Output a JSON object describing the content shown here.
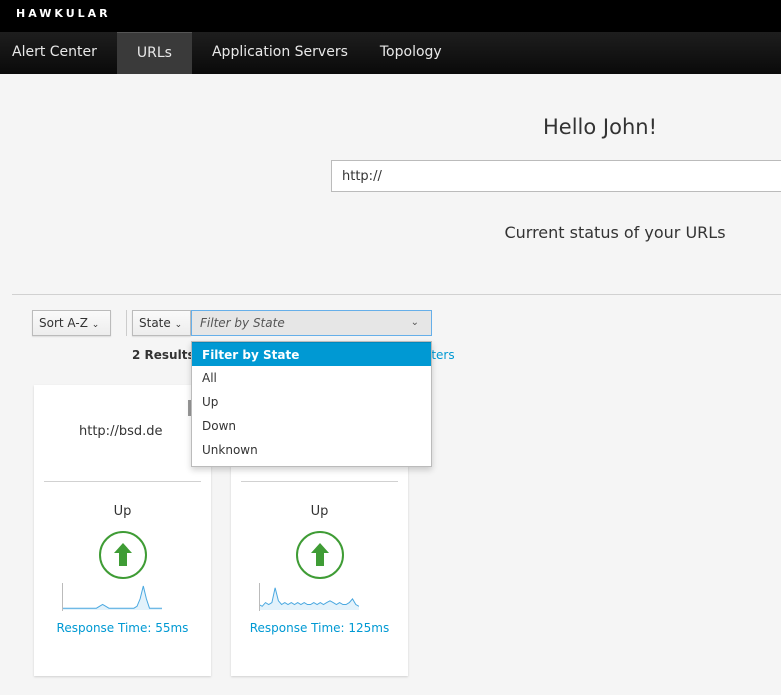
{
  "app": {
    "logo": "HAWKULAR"
  },
  "nav": [
    {
      "label": "Alert Center"
    },
    {
      "label": "URLs",
      "active": true
    },
    {
      "label": "Application Servers"
    },
    {
      "label": "Topology"
    }
  ],
  "main": {
    "greeting": "Hello John!",
    "url_input": {
      "value": "http://"
    },
    "subtitle": "Current status of your URLs"
  },
  "toolbar": {
    "sort_label": "Sort A-Z",
    "state_label": "State",
    "filter_placeholder": "Filter by State",
    "results": "2 Results",
    "clear_filters": "lters"
  },
  "dropdown": {
    "options": [
      "Filter by State",
      "All",
      "Up",
      "Down",
      "Unknown"
    ],
    "selected": "Filter by State"
  },
  "cards": [
    {
      "name": "http://bsd.de",
      "state": "Up",
      "response": "Response Time: 55ms",
      "spark": [
        1,
        1,
        1,
        1,
        1,
        1,
        1,
        1,
        1,
        1,
        1,
        1,
        2,
        3,
        2,
        1,
        1,
        1,
        1,
        1,
        1,
        1,
        1,
        1,
        2,
        6,
        13,
        6,
        1,
        1,
        1,
        1,
        1
      ]
    },
    {
      "name": "",
      "state": "Up",
      "response": "Response Time: 125ms",
      "spark": [
        3,
        2,
        4,
        3,
        4,
        12,
        5,
        3,
        4,
        3,
        4,
        3,
        4,
        3,
        4,
        3,
        3,
        4,
        3,
        4,
        3,
        4,
        5,
        4,
        3,
        4,
        3,
        3,
        4,
        6,
        3,
        2
      ]
    }
  ],
  "colors": {
    "accent": "#0099d3",
    "up": "#3f9c35",
    "nav_bg": "#000000"
  }
}
